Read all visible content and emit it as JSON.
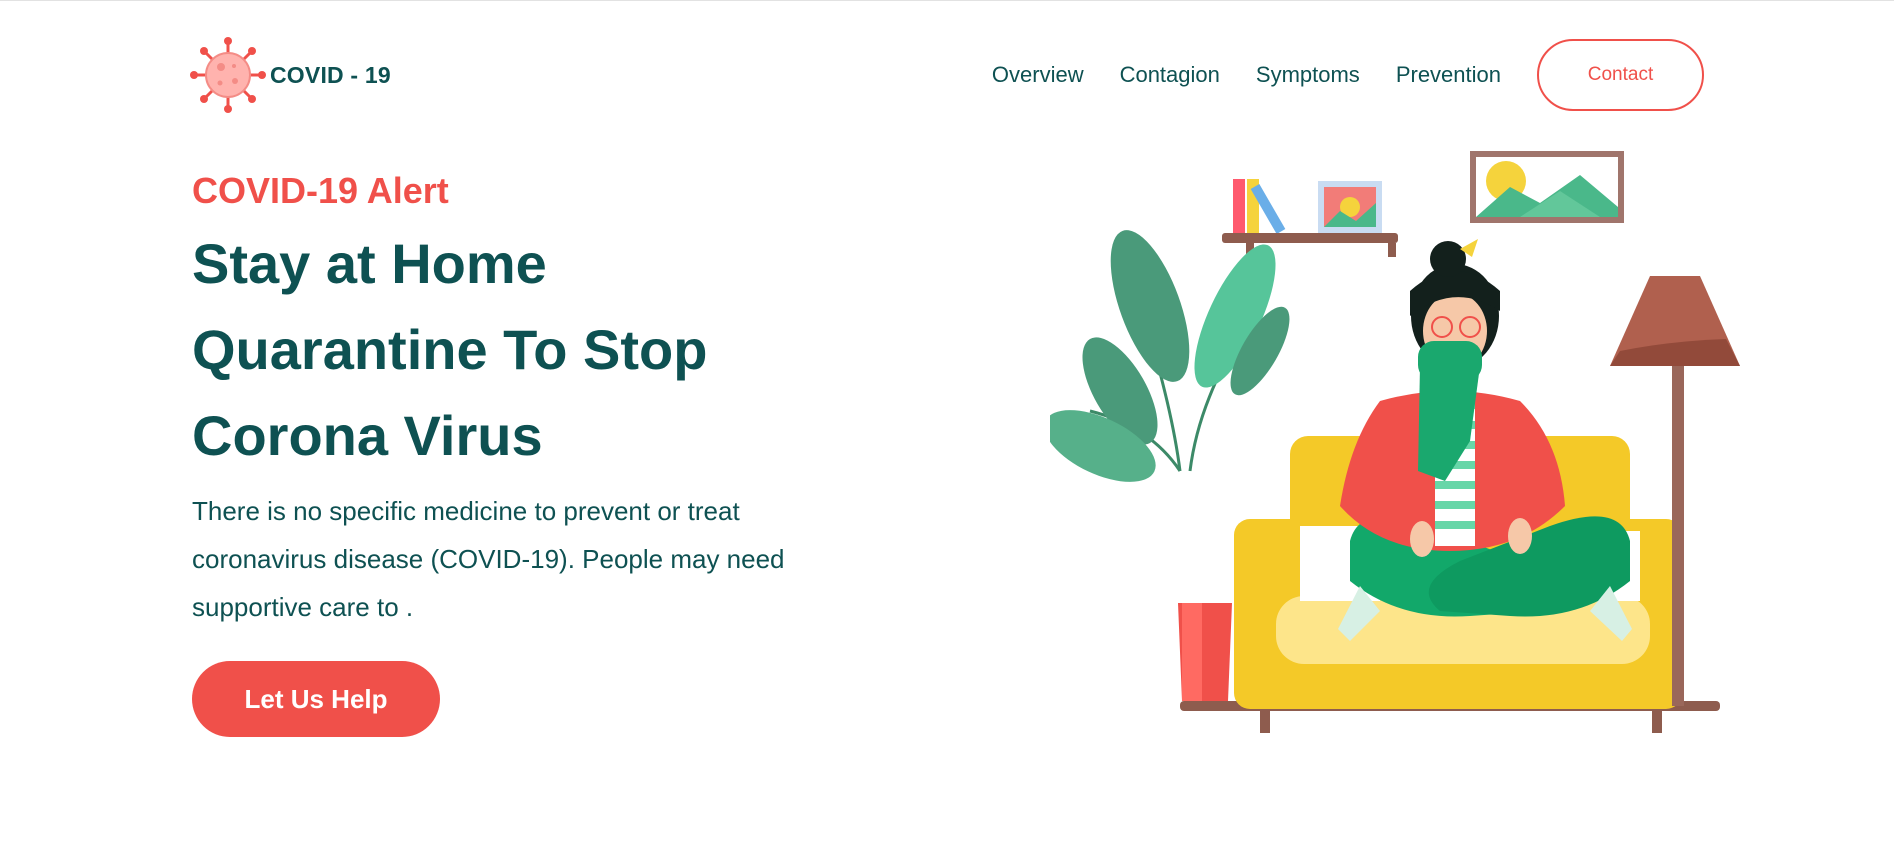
{
  "brand": {
    "name": "COVID - 19",
    "colors": {
      "primary": "#0e5152",
      "accent": "#f0504a"
    }
  },
  "nav": {
    "items": [
      {
        "label": "Overview"
      },
      {
        "label": "Contagion"
      },
      {
        "label": "Symptoms"
      },
      {
        "label": "Prevention"
      }
    ],
    "contact_label": "Contact"
  },
  "hero": {
    "alert": "COVID-19 Alert",
    "headline_lines": [
      "Stay at Home",
      "Quarantine To Stop",
      "Corona Virus"
    ],
    "description": "There is no specific medicine to prevent or treat coronavirus disease (COVID-19). People may need supportive care to .",
    "cta_label": "Let Us Help"
  },
  "illustration": {
    "subject": "woman-wearing-mask-sitting-on-sofa-icon"
  }
}
